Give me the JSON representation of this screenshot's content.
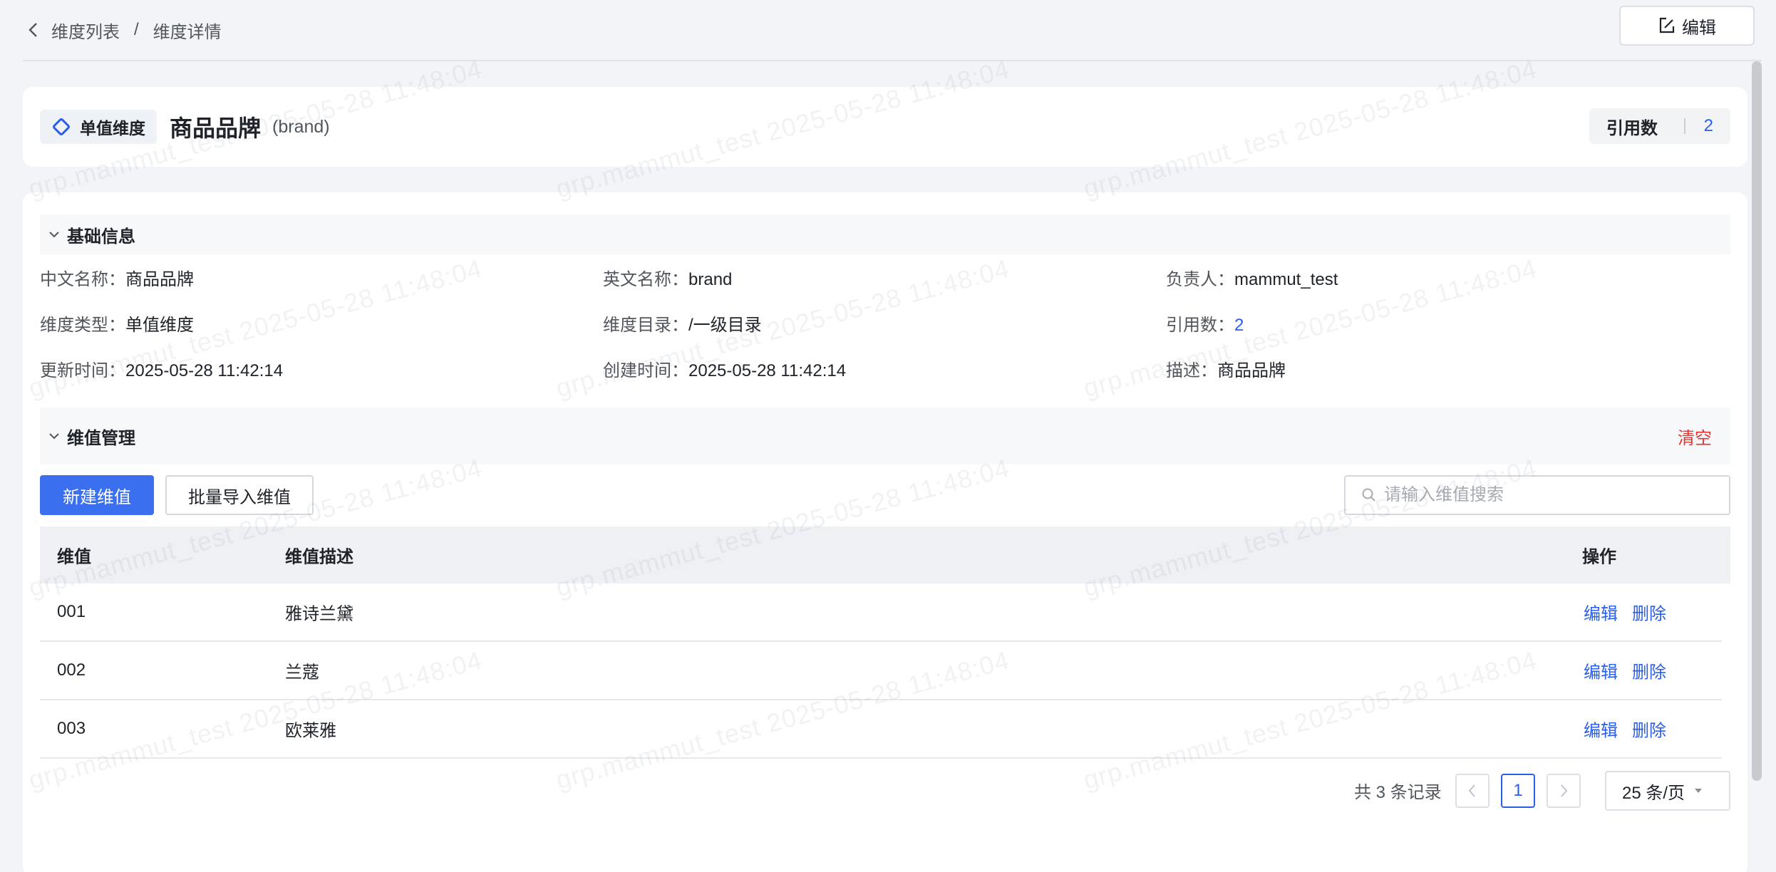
{
  "breadcrumb": {
    "parent": "维度列表",
    "separator": "/",
    "current": "维度详情"
  },
  "topbar": {
    "edit_label": "编辑"
  },
  "header": {
    "type_tag": "单值维度",
    "title": "商品品牌",
    "en_name": "(brand)",
    "ref_label": "引用数",
    "ref_count": "2"
  },
  "basic_info": {
    "section_title": "基础信息",
    "fields": [
      {
        "label": "中文名称：",
        "value": "商品品牌"
      },
      {
        "label": "英文名称：",
        "value": "brand"
      },
      {
        "label": "负责人：",
        "value": "mammut_test"
      },
      {
        "label": "维度类型：",
        "value": "单值维度"
      },
      {
        "label": "维度目录：",
        "value": "/一级目录"
      },
      {
        "label": "引用数：",
        "value": "2"
      },
      {
        "label": "更新时间：",
        "value": "2025-05-28 11:42:14"
      },
      {
        "label": "创建时间：",
        "value": "2025-05-28 11:42:14"
      },
      {
        "label": "描述：",
        "value": "商品品牌"
      }
    ]
  },
  "value_mgmt": {
    "section_title": "维值管理",
    "clear_label": "清空",
    "new_button": "新建维值",
    "import_button": "批量导入维值",
    "search_placeholder": "请输入维值搜索",
    "columns": {
      "value": "维值",
      "desc": "维值描述",
      "op": "操作"
    },
    "rows": [
      {
        "value": "001",
        "desc": "雅诗兰黛",
        "edit": "编辑",
        "delete": "删除"
      },
      {
        "value": "002",
        "desc": "兰蔻",
        "edit": "编辑",
        "delete": "删除"
      },
      {
        "value": "003",
        "desc": "欧莱雅",
        "edit": "编辑",
        "delete": "删除"
      }
    ]
  },
  "pagination": {
    "total_text": "共 3 条记录",
    "current_page": "1",
    "page_size": "25 条/页"
  },
  "watermark": {
    "text": "grp.mammut_test 2025-05-28 11:48:04"
  },
  "colors": {
    "primary": "#3a6ff0",
    "link": "#2b5ee8",
    "danger": "#e5322d"
  }
}
